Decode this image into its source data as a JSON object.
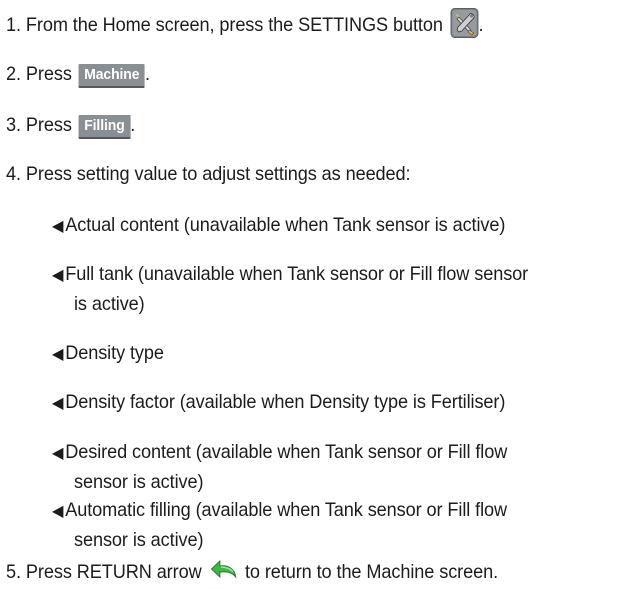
{
  "steps": [
    {
      "number": "1.",
      "text": "From the Home screen, press the SETTINGS button",
      "suffix": "."
    },
    {
      "number": "2.",
      "text": "Press",
      "button": "Machine",
      "suffix": "."
    },
    {
      "number": "3.",
      "text": "Press",
      "button": "Filling",
      "suffix": "."
    },
    {
      "number": "4.",
      "text": "Press setting value to adjust settings as needed:"
    },
    {
      "number": "5.",
      "text": "Press RETURN arrow",
      "after": "to return to the Machine screen."
    }
  ],
  "settings": [
    {
      "line1": "Actual content (unavailable when Tank sensor is active)"
    },
    {
      "line1": "Full tank (unavailable when Tank sensor or Fill flow sensor",
      "line2": "is active)"
    },
    {
      "line1": "Density type"
    },
    {
      "line1": "Density factor (available when Density type is Fertiliser)"
    },
    {
      "line1": "Desired content (available when Tank sensor or Fill flow",
      "line2": "sensor is active)"
    },
    {
      "line1": "Automatic filling (available when Tank sensor or Fill flow",
      "line2": "sensor is active)"
    }
  ],
  "bullet_glyph": "◀",
  "icons": {
    "settings": "settings-tools-icon",
    "return": "return-arrow-icon"
  },
  "colors": {
    "button_bg": "#8a8f94",
    "text": "#1c1c1c",
    "return_arrow": "#39b54a"
  }
}
